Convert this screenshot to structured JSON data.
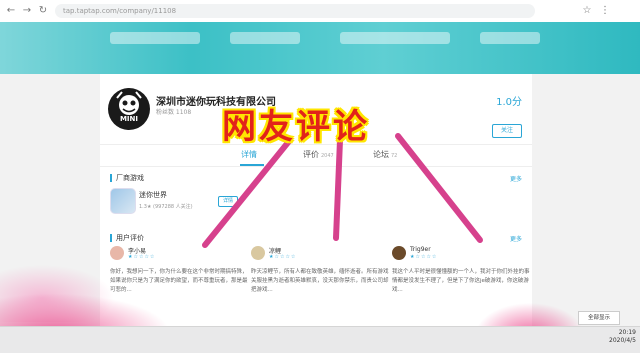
{
  "browser": {
    "url": "tap.taptap.com/company/11108",
    "back": "←",
    "forward": "→",
    "reload": "↻"
  },
  "company": {
    "logo_text": "MINI",
    "name": "深圳市迷你玩科技有限公司",
    "sub": "粉丝数 1108",
    "rating": "1.0分",
    "follow": "关注"
  },
  "tabs": [
    {
      "label": "详情",
      "count": ""
    },
    {
      "label": "评价",
      "count": "2047"
    },
    {
      "label": "论坛",
      "count": "72"
    }
  ],
  "vendor_games": {
    "title": "厂商游戏",
    "more": "更多",
    "game": {
      "name": "迷你世界",
      "score": "1.3★",
      "meta": "(997288 人关注)",
      "detail": "详情"
    }
  },
  "user_reviews": {
    "title": "用户评价",
    "more": "更多",
    "items": [
      {
        "name": "李小易",
        "stars": "★☆☆☆☆",
        "avatar_color": "#e8b7a8",
        "text": "你好，我想问一下，你为什么要在这个非常时期搞特殊，如果说你只是为了满足你的欲望，而不尊重玩者，那是最可悲的..."
      },
      {
        "name": "凉鲤",
        "stars": "★☆☆☆☆",
        "avatar_color": "#d9c8a0",
        "text": "昨天凉鲤节，所有人都在致敬英雄，缅怀逝者。所有游戏关服挂黑为逝者和英雄默哀，没天那你禁乐，而贵公司却把游戏..."
      },
      {
        "name": "Trig9er",
        "stars": "★☆☆☆☆",
        "avatar_color": "#6b4a2a",
        "text": "我这个人平时是很懂懂额的一个人，我对于你们外挂的事情都是没发生不理了，但是下了你这je破游戏，你这破游戏..."
      }
    ]
  },
  "overlay": {
    "headline": "网友评论",
    "headline_color": "#e2231a",
    "arrow_color": "#d6418d"
  },
  "taskbar": {
    "show_all": "全部显示",
    "time": "20:19",
    "date": "2020/4/5"
  }
}
